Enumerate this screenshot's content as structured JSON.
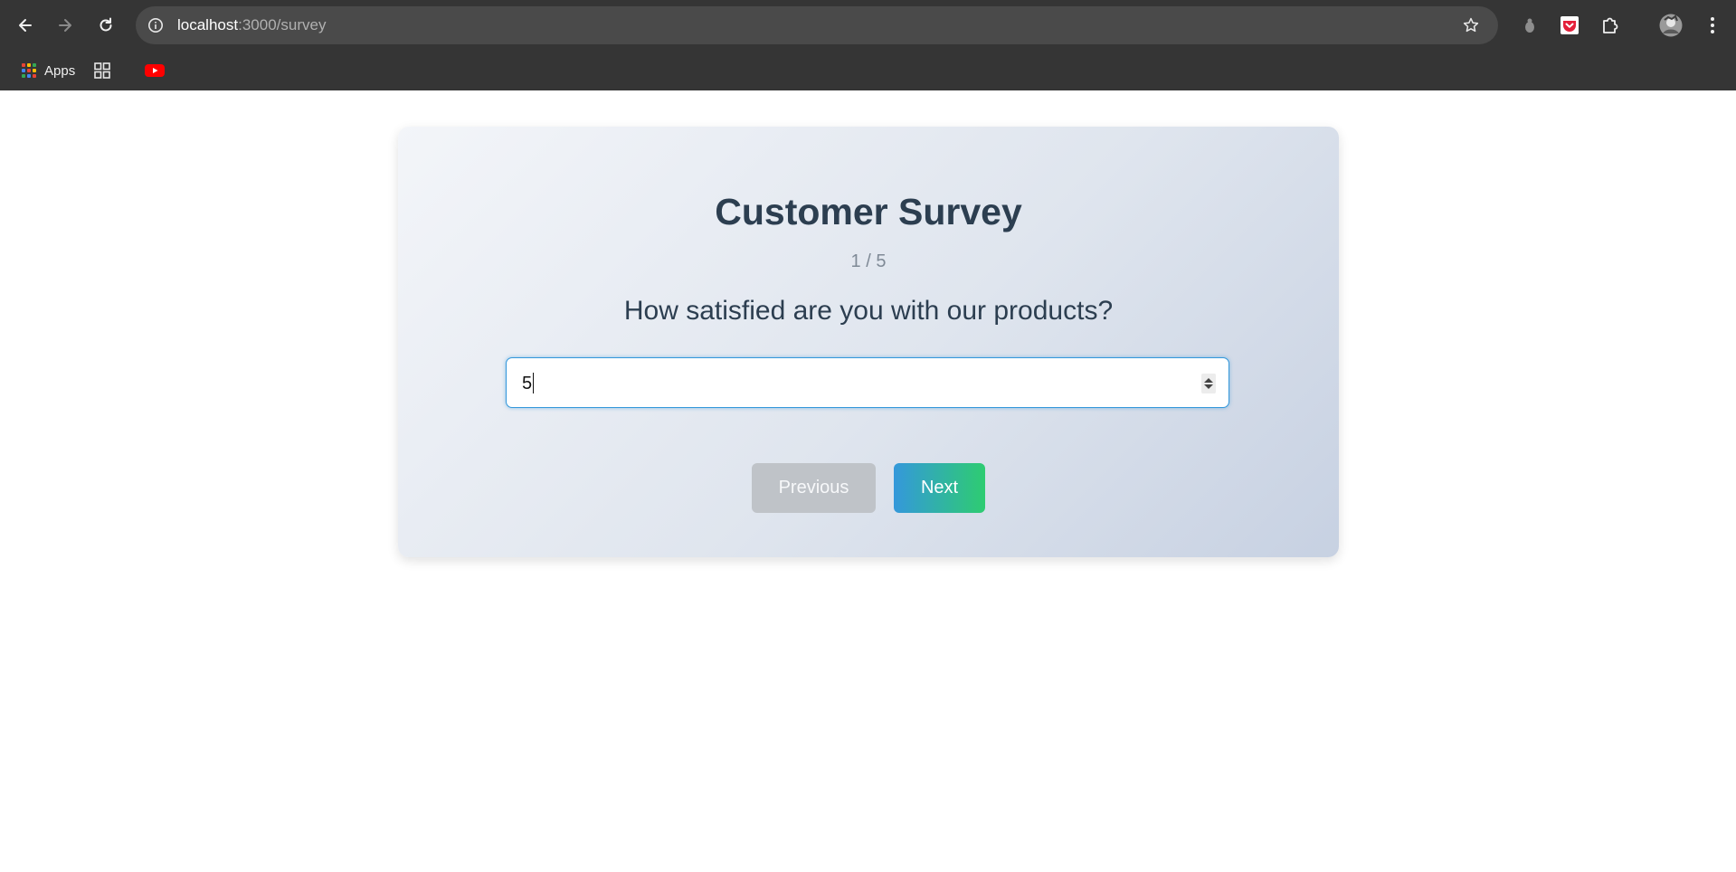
{
  "browser": {
    "url_host": "localhost",
    "url_path": ":3000/survey",
    "bookmarks": {
      "apps_label": "Apps"
    },
    "colors": {
      "chrome_bg": "#353535",
      "omnibox_bg": "#4a4a4a",
      "youtube_red": "#ff0000"
    }
  },
  "survey": {
    "title": "Customer Survey",
    "progress": "1 / 5",
    "question": "How satisfied are you with our products?",
    "answer_value": "5",
    "previous_label": "Previous",
    "next_label": "Next",
    "colors": {
      "title": "#2c3e50",
      "input_border": "#3498db",
      "prev_button": "#bfc3c8",
      "next_gradient_start": "#3498db",
      "next_gradient_end": "#2ecc71"
    }
  },
  "icons": [
    "back-arrow-icon",
    "forward-arrow-icon",
    "reload-icon",
    "site-info-icon",
    "bookmark-star-icon",
    "extension-dot-icon",
    "pocket-icon",
    "puzzle-extensions-icon",
    "profile-avatar-icon",
    "more-menu-icon",
    "apps-grid-icon",
    "tab-groups-icon",
    "youtube-icon"
  ]
}
